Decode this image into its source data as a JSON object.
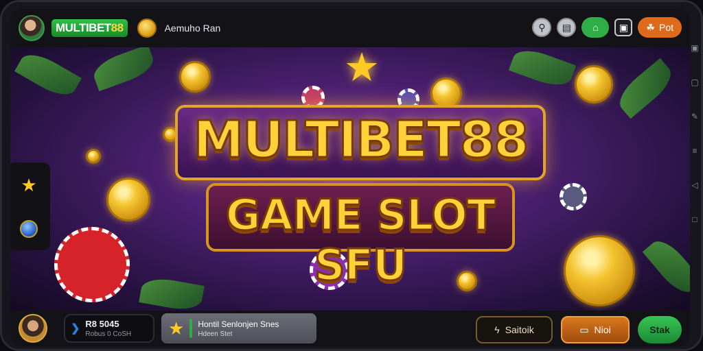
{
  "topbar": {
    "logo_text_a": "MULTIBET",
    "logo_text_b": "88",
    "label": "Aemuho Ran",
    "buttons": [
      {
        "name": "search-button",
        "icon": "search-icon",
        "glyph": "⚲"
      },
      {
        "name": "gift-button",
        "icon": "gift-icon",
        "glyph": "▤"
      },
      {
        "name": "home-button",
        "icon": "home-icon",
        "glyph": "⌂"
      },
      {
        "name": "copy-button",
        "icon": "copy-icon",
        "glyph": "▣"
      }
    ],
    "bot_button": {
      "icon": "bot-icon",
      "glyph": "☘",
      "label": "Pot"
    }
  },
  "banner": {
    "title_line1": "MULTIBET88",
    "title_line2": "GAME SLOT SFU"
  },
  "sidebar": {
    "icons": [
      "star-icon",
      "globe-icon"
    ]
  },
  "bottombar": {
    "balance_main": "R8 5045",
    "balance_sub": "Robus 0 CoSH",
    "promo_line1": "Hontil Senlonjen Snes",
    "promo_line2": "Hdeen Stet",
    "collect_label": "Saitoik",
    "mid_label": "Nioi",
    "go_label": "Stak"
  },
  "colors": {
    "accent_green": "#2fae48",
    "accent_orange": "#e06a1c",
    "title_gold": "#ffd23a"
  }
}
